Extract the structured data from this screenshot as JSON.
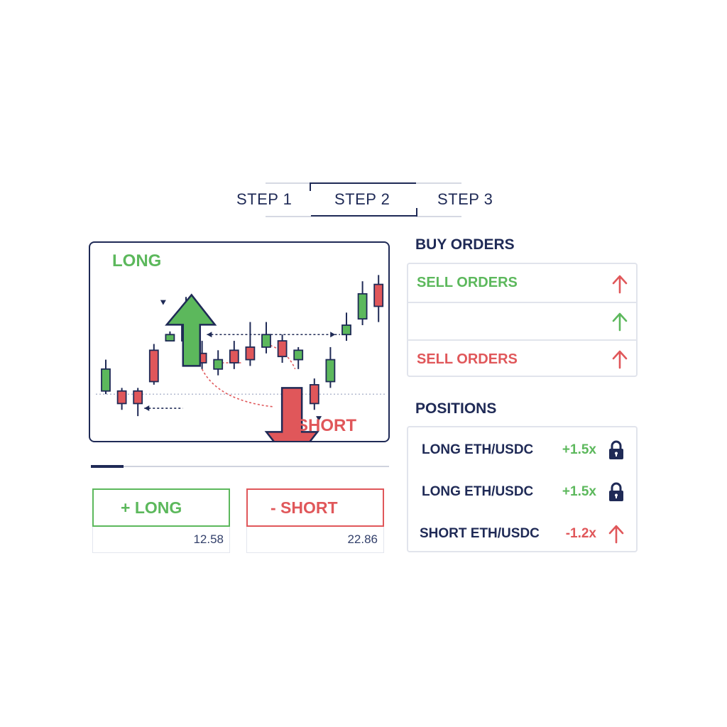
{
  "colors": {
    "navy": "#1f2a56",
    "green": "#5cb85c",
    "red": "#e0575a",
    "border": "#e1e4ec"
  },
  "steps": [
    {
      "label": "STEP 1",
      "active": false
    },
    {
      "label": "STEP 2",
      "active": true
    },
    {
      "label": "STEP 3",
      "active": false
    }
  ],
  "chart": {
    "long_label": "LONG",
    "short_label": "SHORT",
    "progress_fraction": 0.11
  },
  "chart_data": {
    "type": "candlestick",
    "title": "",
    "xlabel": "",
    "ylabel": "",
    "candles": [
      {
        "open": 45,
        "close": 52,
        "high": 55,
        "low": 44
      },
      {
        "open": 45,
        "close": 41,
        "high": 46,
        "low": 39
      },
      {
        "open": 45,
        "close": 41,
        "high": 46,
        "low": 37
      },
      {
        "open": 58,
        "close": 48,
        "high": 60,
        "low": 47
      },
      {
        "open": 61,
        "close": 63,
        "high": 64,
        "low": 61
      },
      {
        "open": 66,
        "close": 61,
        "high": 75,
        "low": 57
      },
      {
        "open": 57,
        "close": 54,
        "high": 61,
        "low": 52
      },
      {
        "open": 52,
        "close": 55,
        "high": 58,
        "low": 50
      },
      {
        "open": 58,
        "close": 54,
        "high": 61,
        "low": 52
      },
      {
        "open": 59,
        "close": 55,
        "high": 67,
        "low": 53
      },
      {
        "open": 59,
        "close": 63,
        "high": 67,
        "low": 57
      },
      {
        "open": 61,
        "close": 56,
        "high": 63,
        "low": 54
      },
      {
        "open": 55,
        "close": 58,
        "high": 59,
        "low": 52
      },
      {
        "open": 47,
        "close": 41,
        "high": 49,
        "low": 39
      },
      {
        "open": 48,
        "close": 55,
        "high": 59,
        "low": 46
      },
      {
        "open": 63,
        "close": 66,
        "high": 70,
        "low": 61
      },
      {
        "open": 68,
        "close": 76,
        "high": 80,
        "low": 66
      },
      {
        "open": 79,
        "close": 72,
        "high": 82,
        "low": 67
      },
      {
        "open": 77,
        "close": 73,
        "high": 78,
        "low": 68
      }
    ],
    "ylim": [
      30,
      90
    ]
  },
  "trade": {
    "long_button": "+ LONG",
    "short_button": "- SHORT",
    "long_value": "12.58",
    "short_value": "22.86"
  },
  "orders": {
    "title": "BUY ORDERS",
    "rows": [
      {
        "label": "SELL ORDERS",
        "icon": "arrow-up-icon",
        "color": "#5cb85c",
        "icon_color": "#e0575a"
      },
      {
        "label": "",
        "icon": "arrow-up-icon",
        "color": "#5cb85c",
        "icon_color": "#5cb85c"
      },
      {
        "label": "SELL ORDERS",
        "icon": "arrow-up-icon",
        "color": "#e0575a",
        "icon_color": "#e0575a"
      }
    ]
  },
  "positions": {
    "title": "POSITIONS",
    "rows": [
      {
        "name": "LONG ETH/USDC",
        "leverage": "+1.5x",
        "icon": "lock-icon",
        "color": "#5cb85c"
      },
      {
        "name": "LONG ETH/USDC",
        "leverage": "+1.5x",
        "icon": "lock-icon",
        "color": "#5cb85c"
      },
      {
        "name": "SHORT ETH/USDC",
        "leverage": "-1.2x",
        "icon": "arrow-up-icon",
        "color": "#e0575a"
      }
    ]
  }
}
